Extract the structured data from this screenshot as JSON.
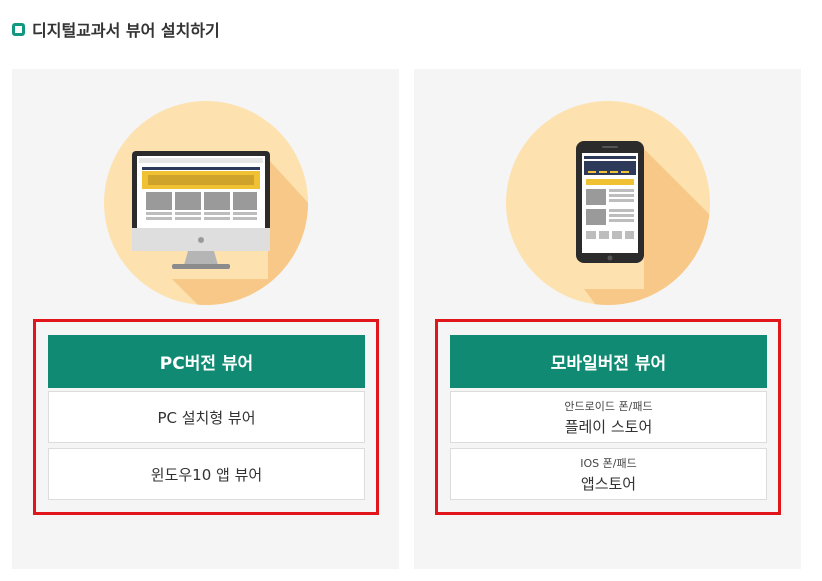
{
  "section": {
    "title": "디지털교과서 뷰어 설치하기"
  },
  "pc": {
    "heading": "PC버전 뷰어",
    "options": [
      {
        "label": "PC 설치형 뷰어"
      },
      {
        "label": "윈도우10 앱 뷰어"
      }
    ],
    "illustration_icon": "desktop-monitor-icon"
  },
  "mobile": {
    "heading": "모바일버전 뷰어",
    "options": [
      {
        "sublabel": "안드로이드 폰/패드",
        "label": "플레이 스토어"
      },
      {
        "sublabel": "IOS 폰/패드",
        "label": "앱스토어"
      }
    ],
    "illustration_icon": "smartphone-icon"
  },
  "colors": {
    "accent": "#118a74",
    "title_marker": "#13977f",
    "highlight_border": "#e0161b",
    "card_background": "#f5f5f5",
    "circle": "#fde2b0",
    "circle_shadow": "#f7c887"
  }
}
